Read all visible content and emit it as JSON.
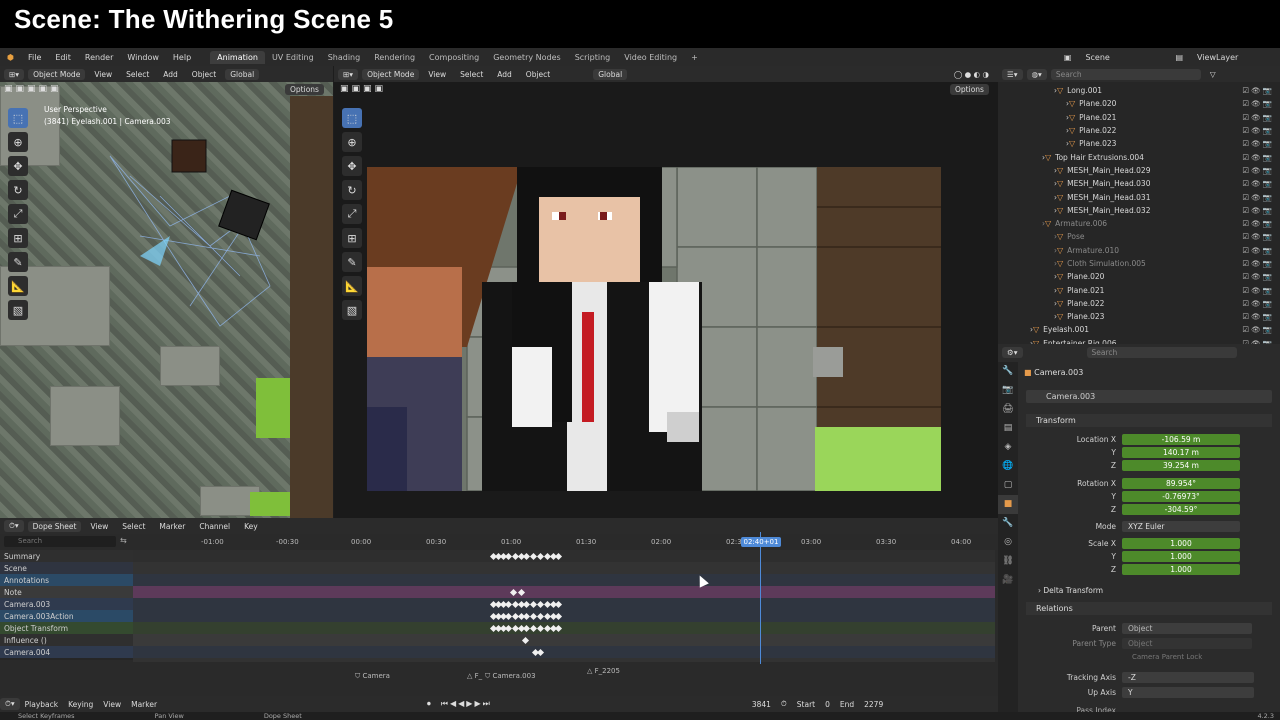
{
  "overlay_title": "Scene: The Withering Scene 5",
  "menu": [
    "File",
    "Edit",
    "Render",
    "Window",
    "Help"
  ],
  "workspaces": [
    {
      "label": "Animation",
      "active": true
    },
    {
      "label": "UV Editing"
    },
    {
      "label": "Shading"
    },
    {
      "label": "Rendering"
    },
    {
      "label": "Compositing"
    },
    {
      "label": "Geometry Nodes"
    },
    {
      "label": "Scripting"
    },
    {
      "label": "Video Editing"
    }
  ],
  "scene_selector": {
    "label": "Scene",
    "view_layer": "ViewLayer"
  },
  "left_viewport": {
    "mode": "Object Mode",
    "menus": [
      "View",
      "Select",
      "Add",
      "Object"
    ],
    "orientation": "Global",
    "options": "Options",
    "overlay_line1": "User Perspective",
    "overlay_line2": "(3841) Eyelash.001 | Camera.003"
  },
  "main_viewport": {
    "mode": "Object Mode",
    "menus": [
      "View",
      "Select",
      "Add",
      "Object"
    ],
    "orientation": "Global",
    "options": "Options"
  },
  "outliner": {
    "search_placeholder": "Search",
    "rows": [
      {
        "name": "Long.001",
        "indent": 4
      },
      {
        "name": "Plane.020",
        "indent": 5
      },
      {
        "name": "Plane.021",
        "indent": 5
      },
      {
        "name": "Plane.022",
        "indent": 5
      },
      {
        "name": "Plane.023",
        "indent": 5
      },
      {
        "name": "Top Hair Extrusions.004",
        "indent": 3
      },
      {
        "name": "MESH_Main_Head.029",
        "indent": 4
      },
      {
        "name": "MESH_Main_Head.030",
        "indent": 4
      },
      {
        "name": "MESH_Main_Head.031",
        "indent": 4
      },
      {
        "name": "MESH_Main_Head.032",
        "indent": 4
      },
      {
        "name": "Armature.006",
        "indent": 3,
        "dim": true
      },
      {
        "name": "Pose",
        "indent": 4,
        "dim": true
      },
      {
        "name": "Armature.010",
        "indent": 4,
        "dim": true
      },
      {
        "name": "Cloth Simulation.005",
        "indent": 4,
        "dim": true
      },
      {
        "name": "Plane.020",
        "indent": 4
      },
      {
        "name": "Plane.021",
        "indent": 4
      },
      {
        "name": "Plane.022",
        "indent": 4
      },
      {
        "name": "Plane.023",
        "indent": 4
      },
      {
        "name": "Eyelash.001",
        "indent": 2
      },
      {
        "name": "Entertainer Rig.006",
        "indent": 2
      }
    ]
  },
  "properties": {
    "search_placeholder": "Search",
    "object_name": "Camera.003",
    "object_name_field": "Camera.003",
    "transform_label": "Transform",
    "location_x_label": "Location X",
    "location_x": "-106.59 m",
    "location_y_label": "Y",
    "location_y": "140.17 m",
    "location_z_label": "Z",
    "location_z": "39.254 m",
    "rotation_x_label": "Rotation X",
    "rotation_x": "89.954°",
    "rotation_y_label": "Y",
    "rotation_y": "-0.76973°",
    "rotation_z_label": "Z",
    "rotation_z": "-304.59°",
    "mode_label": "Mode",
    "mode_value": "XYZ Euler",
    "scale_x_label": "Scale X",
    "scale_x": "1.000",
    "scale_y_label": "Y",
    "scale_y": "1.000",
    "scale_z_label": "Z",
    "scale_z": "1.000",
    "delta_label": "Delta Transform",
    "relations_label": "Relations",
    "parent_label": "Parent",
    "parent_placeholder": "Object",
    "parent_type_label": "Parent Type",
    "parent_type_value": "Object",
    "camera_parent_lock": "Camera Parent Lock",
    "tracking_axis_label": "Tracking Axis",
    "tracking_axis_value": "-Z",
    "up_axis_label": "Up Axis",
    "up_axis_value": "Y",
    "pass_index_label": "Pass Index"
  },
  "dopesheet": {
    "editor": "Dope Sheet",
    "menus": [
      "View",
      "Select",
      "Marker",
      "Channel",
      "Key"
    ],
    "search_placeholder": "Search",
    "ruler": [
      "-01:00",
      "-00:30",
      "00:00",
      "00:30",
      "01:00",
      "01:30",
      "02:00",
      "02:30",
      "03:00",
      "03:30",
      "04:00"
    ],
    "current_frame_label": "02:40+01",
    "channels": [
      {
        "name": "Summary",
        "color": "#2f2f2f"
      },
      {
        "name": "Scene",
        "color": "#2f3440"
      },
      {
        "name": "Annotations",
        "color": "#2b4a66"
      },
      {
        "name": "Note",
        "color": "#3a3a3a"
      },
      {
        "name": "Camera.003",
        "color": "#2f3a4e"
      },
      {
        "name": "Camera.003Action",
        "color": "#2b4a66"
      },
      {
        "name": "Object Transform",
        "color": "#344a2f"
      },
      {
        "name": "Influence ()",
        "color": "#2f2f2f"
      },
      {
        "name": "Camera.004",
        "color": "#2f3a4e"
      }
    ],
    "markers": [
      "Camera",
      "F_",
      "Camera.003",
      "F_2205"
    ]
  },
  "timeline": {
    "menus": [
      "Playback",
      "Keying",
      "View",
      "Marker"
    ],
    "current_frame": "3841",
    "start_label": "Start",
    "start_value": "0",
    "end_label": "End",
    "end_value": "2279"
  },
  "status_bar": [
    "Select Keyframes",
    "Pan View",
    "Dope Sheet"
  ],
  "version": "4.2.3"
}
